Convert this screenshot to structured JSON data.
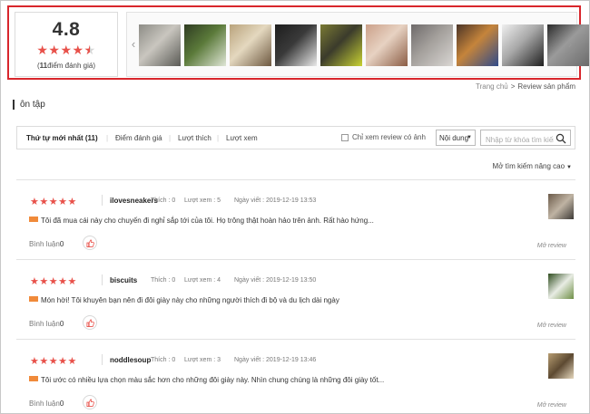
{
  "summary": {
    "score": "4.8",
    "stars": "★★★★",
    "rating_count_number": "11",
    "rating_count_label": "điểm đánh giá",
    "open_paren": "(",
    "close_paren": ")"
  },
  "thumbnails": [
    {
      "colors": [
        "#8d8c86",
        "#5a5a55",
        "#c9c6bf"
      ]
    },
    {
      "colors": [
        "#2f3c22",
        "#dfe6d6",
        "#5b7a3a"
      ]
    },
    {
      "colors": [
        "#b9a37c",
        "#6d5840",
        "#e4d8bf"
      ]
    },
    {
      "colors": [
        "#1d1d1d",
        "#e9e9e9",
        "#3a3a3a"
      ]
    },
    {
      "colors": [
        "#7a7a33",
        "#c8d233",
        "#3b3b2c"
      ]
    },
    {
      "colors": [
        "#cba089",
        "#8b5d45",
        "#e7d2c2"
      ]
    },
    {
      "colors": [
        "#6e6a6a",
        "#d9d6d3",
        "#a4a09c"
      ]
    },
    {
      "colors": [
        "#4a3427",
        "#2f4a8a",
        "#c5843b"
      ]
    },
    {
      "colors": [
        "#efefef",
        "#1f1f1f",
        "#a8a8a8"
      ]
    },
    {
      "colors": [
        "#2a2a2a",
        "#6b6b6b",
        "#9a9a9a"
      ]
    }
  ],
  "breadcrumb": {
    "home": "Trang chủ",
    "separator": ">",
    "current": "Review sản phẩm"
  },
  "section_title": "ôn tập",
  "filter": {
    "tabs": [
      {
        "label": "Thứ tự mới nhất (11)",
        "active": true
      },
      {
        "label": "Điểm đánh giá",
        "active": false
      },
      {
        "label": "Lượt thích",
        "active": false
      },
      {
        "label": "Lượt xem",
        "active": false
      }
    ],
    "photo_only_label": "Chỉ xem review có ảnh",
    "select_value": "Nội dung",
    "search_placeholder": "Nhập từ khóa tìm kiếm"
  },
  "advanced_search_label": "Mở tìm kiếm nâng cao",
  "colors": {
    "accent_red": "#d8262c",
    "star": "#e8514a",
    "new_badge": "#f08a3a"
  },
  "reviews": [
    {
      "stars": "★★★★★",
      "user": "ilovesneakers",
      "likes": "Thích : 0",
      "views": "Lượt xem : 5",
      "date": "Ngày viết : 2019-12-19 13:53",
      "text": "Tôi đã mua cái này cho chuyến đi nghỉ sắp tới của tôi. Họ trông thật hoàn hảo trên ảnh. Rất hào hứng...",
      "comment_label": "Bình luận",
      "comment_count": "0",
      "more": "Mở review",
      "thumb_colors": [
        "#6b5a49",
        "#bfb3a3",
        "#3d3a36"
      ]
    },
    {
      "stars": "★★★★★",
      "user": "biscuits",
      "likes": "Thích : 0",
      "views": "Lượt xem : 4",
      "date": "Ngày viết : 2019-12-19 13:50",
      "text": "Món hời! Tôi khuyên bạn nên đi đôi giày này cho những người thích đi bộ và du lịch dài ngày",
      "comment_label": "Bình luận",
      "comment_count": "0",
      "more": "Mở review",
      "thumb_colors": [
        "#2f4d1f",
        "#e8ece4",
        "#6f8f46"
      ]
    },
    {
      "stars": "★★★★★",
      "user": "noddlesoup",
      "likes": "Thích : 0",
      "views": "Lượt xem : 3",
      "date": "Ngày viết : 2019-12-19 13:46",
      "text": "Tôi ước có nhiều lựa chọn màu sắc hơn cho những đôi giày này. Nhìn chung chúng là những đôi giày tốt...",
      "comment_label": "Bình luận",
      "comment_count": "0",
      "more": "Mở review",
      "thumb_colors": [
        "#b79d72",
        "#5d4a32",
        "#e5d7bd"
      ]
    }
  ]
}
